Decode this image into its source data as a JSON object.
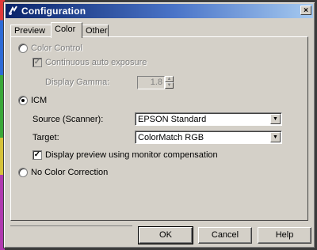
{
  "window": {
    "title": "Configuration",
    "close_label": "×"
  },
  "tabs": [
    {
      "label": "Preview",
      "active": false
    },
    {
      "label": "Color",
      "active": true
    },
    {
      "label": "Other",
      "active": false
    }
  ],
  "color_tab": {
    "color_control": {
      "label": "Color Control",
      "selected": false
    },
    "continuous_auto_exposure": {
      "label": "Continuous auto exposure",
      "checked": true,
      "enabled": false
    },
    "display_gamma": {
      "label": "Display Gamma:",
      "value": "1.8",
      "enabled": false
    },
    "icm": {
      "label": "ICM",
      "selected": true
    },
    "source": {
      "label": "Source (Scanner):",
      "value": "EPSON Standard"
    },
    "target": {
      "label": "Target:",
      "value": "ColorMatch RGB"
    },
    "display_preview": {
      "label": "Display preview using monitor compensation",
      "checked": true
    },
    "no_color_correction": {
      "label": "No Color Correction",
      "selected": false
    }
  },
  "buttons": {
    "ok": "OK",
    "cancel": "Cancel",
    "help": "Help"
  },
  "colors": {
    "title_start": "#0a246a",
    "title_end": "#a6caf0",
    "face": "#d4d0c8"
  }
}
